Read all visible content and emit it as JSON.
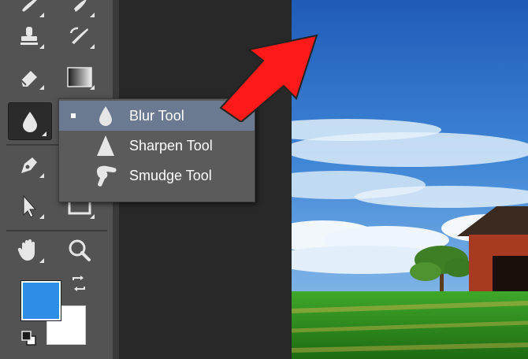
{
  "flyout": {
    "items": [
      {
        "label": "Blur Tool",
        "icon": "blur-drop-icon",
        "selected": true
      },
      {
        "label": "Sharpen Tool",
        "icon": "sharpen-cone-icon",
        "selected": false
      },
      {
        "label": "Smudge Tool",
        "icon": "smudge-finger-icon",
        "selected": false
      }
    ]
  },
  "colors": {
    "foreground": "#2e8de4",
    "background": "#ffffff",
    "annotation_arrow": "#ff1a1a"
  },
  "toolbar": {
    "tools": [
      "brush-icon",
      "history-brush-icon",
      "clone-stamp-icon",
      "history-brush-alt-icon",
      "eraser-icon",
      "gradient-icon",
      "blur-icon",
      "pen-icon",
      "text-icon",
      "path-select-icon",
      "rectangle-icon",
      "hand-icon",
      "zoom-icon",
      "swap-colors-icon",
      "default-colors-icon"
    ]
  }
}
